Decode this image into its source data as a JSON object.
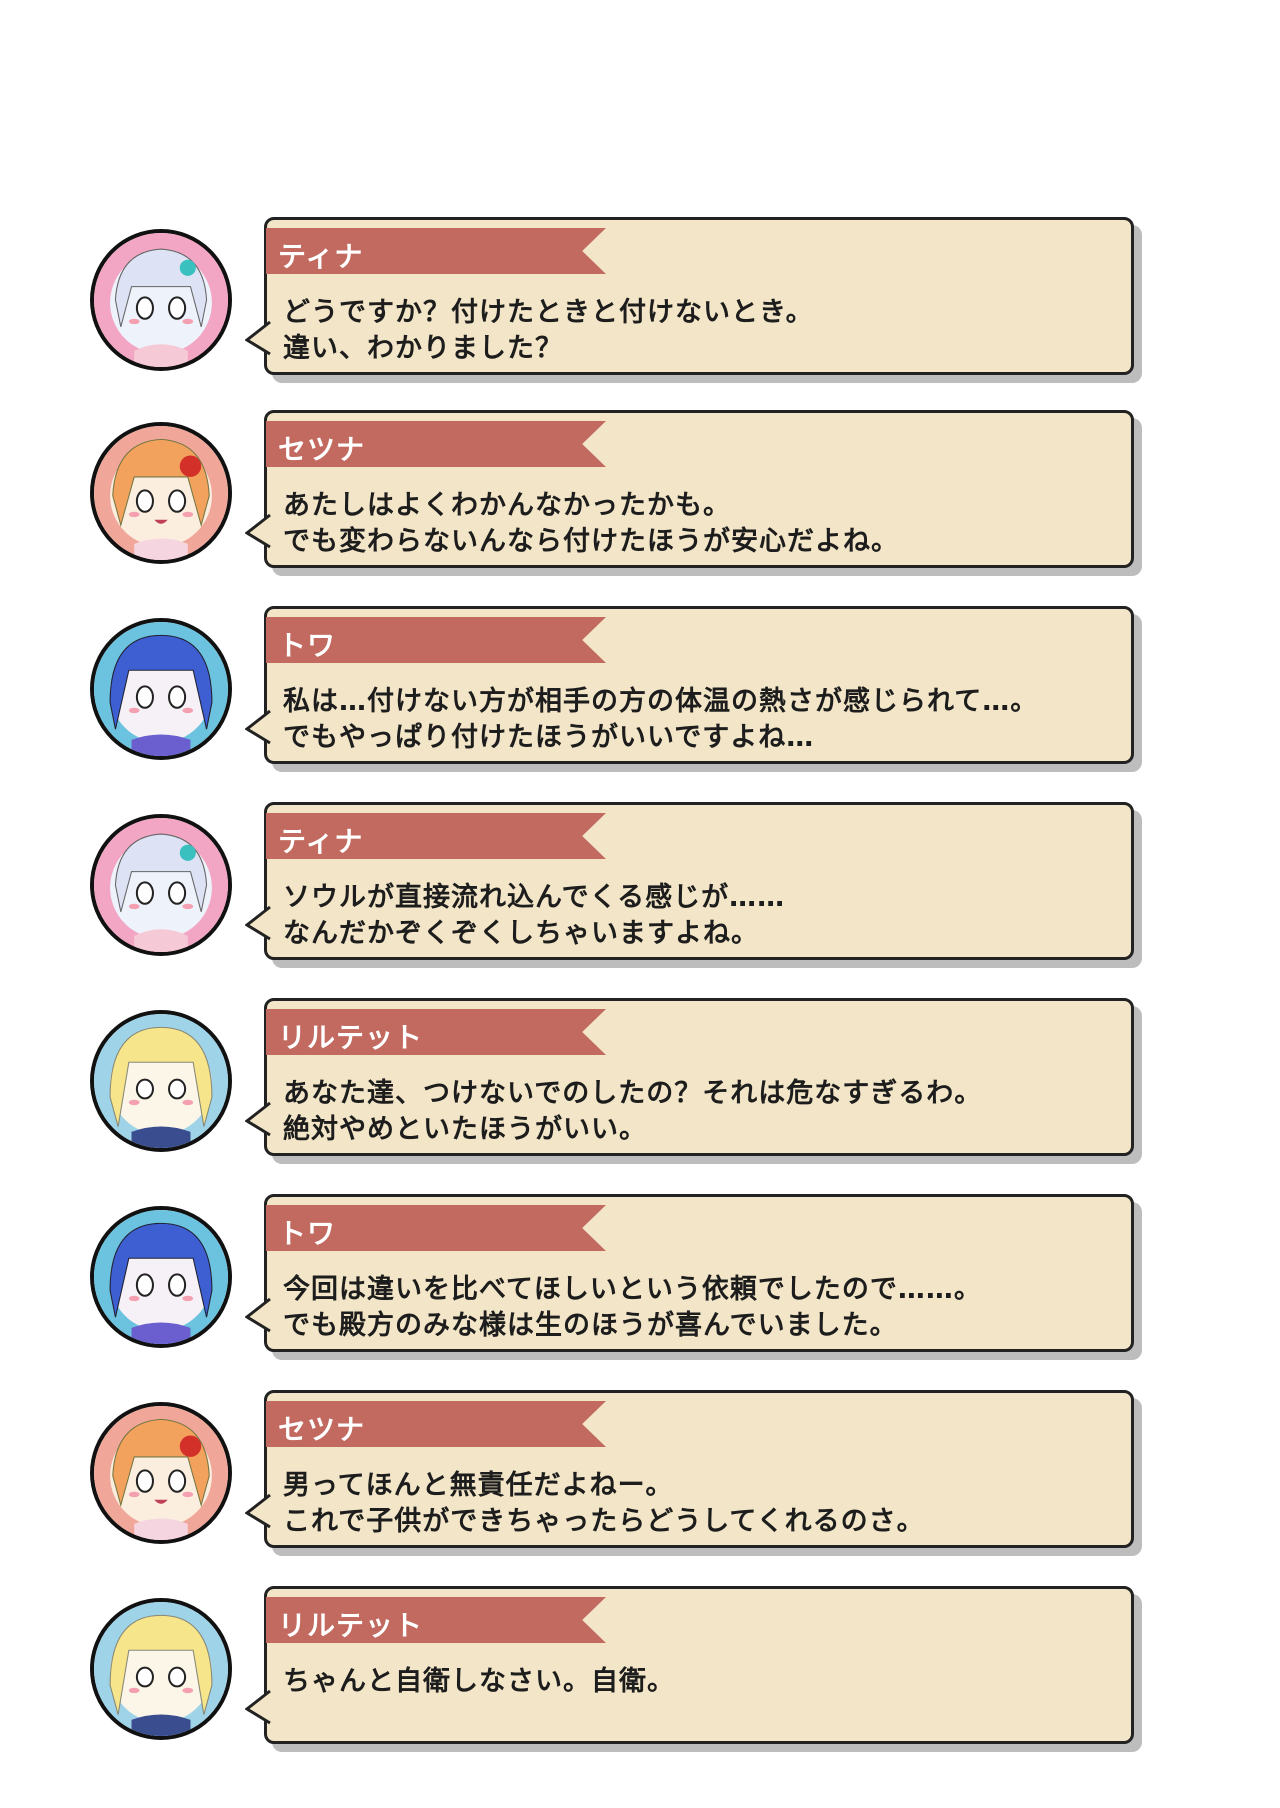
{
  "dialogue": [
    {
      "speaker": "ティナ",
      "portrait": "tina-portrait",
      "lines": [
        "どうですか？付けたときと付けないとき。",
        "違い、わかりました？"
      ]
    },
    {
      "speaker": "セツナ",
      "portrait": "setsuna-portrait",
      "lines": [
        "あたしはよくわかんなかったかも。",
        "でも変わらないんなら付けたほうが安心だよね。"
      ]
    },
    {
      "speaker": "トワ",
      "portrait": "towa-portrait",
      "lines": [
        "私は…付けない方が相手の方の体温の熱さが感じられて…。",
        "でもやっぱり付けたほうがいいですよね…"
      ]
    },
    {
      "speaker": "ティナ",
      "portrait": "tina-portrait",
      "lines": [
        "ソウルが直接流れ込んでくる感じが……",
        "なんだかぞくぞくしちゃいますよね。"
      ]
    },
    {
      "speaker": "リルテット",
      "portrait": "riltet-portrait",
      "lines": [
        "あなた達、つけないでのしたの？それは危なすぎるわ。",
        "絶対やめといたほうがいい。"
      ]
    },
    {
      "speaker": "トワ",
      "portrait": "towa-portrait",
      "lines": [
        "今回は違いを比べてほしいという依頼でしたので……。",
        "でも殿方のみな様は生のほうが喜んでいました。"
      ]
    },
    {
      "speaker": "セツナ",
      "portrait": "setsuna-portrait",
      "lines": [
        "男ってほんと無責任だよねー。",
        "これで子供ができちゃったらどうしてくれるのさ。"
      ]
    },
    {
      "speaker": "リルテット",
      "portrait": "riltet-portrait",
      "lines": [
        "ちゃんと自衛しなさい。自衛。",
        ""
      ]
    }
  ],
  "colors": {
    "banner": "#c26a5f",
    "bubble": "#f3e6c8",
    "tina_ring": "#f2a6c4",
    "setsuna_ring": "#f0a79a",
    "towa_ring": "#6cc3df",
    "riltet_ring": "#9ed3e8"
  }
}
